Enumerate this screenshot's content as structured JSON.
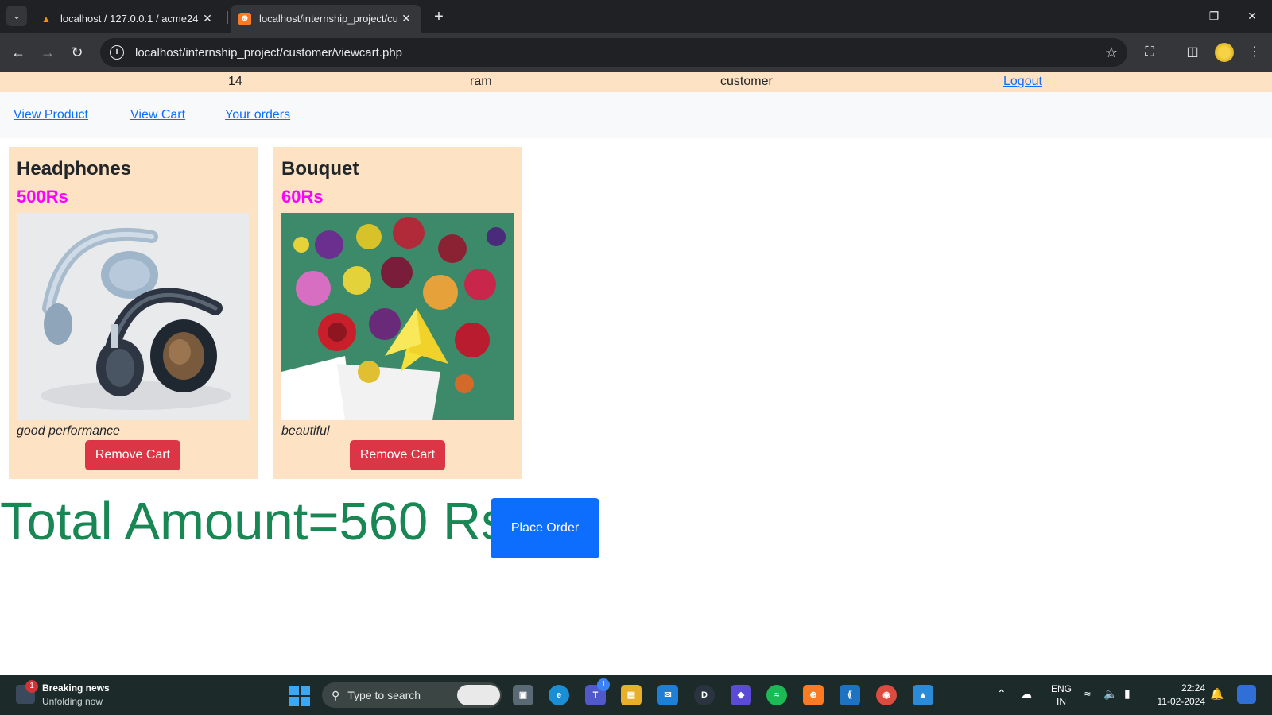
{
  "browser": {
    "tabs": [
      {
        "title": "localhost / 127.0.0.1 / acme24 /",
        "icon": "phpmyadmin-icon",
        "active": false
      },
      {
        "title": "localhost/internship_project/cu",
        "icon": "xampp-icon",
        "active": true
      }
    ],
    "url": "localhost/internship_project/customer/viewcart.php"
  },
  "page": {
    "info_bar": {
      "user_id": "14",
      "username": "ram",
      "role": "customer",
      "logout_label": "Logout"
    },
    "nav": {
      "view_product": "View Product",
      "view_cart": "View Cart",
      "your_orders": "Your orders"
    },
    "cart_items": [
      {
        "name": "Headphones",
        "price": "500Rs",
        "description": "good performance",
        "remove_label": "Remove Cart"
      },
      {
        "name": "Bouquet",
        "price": "60Rs",
        "description": "beautiful",
        "remove_label": "Remove Cart"
      }
    ],
    "total_text": "Total Amount=560 Rs",
    "place_order_label": "Place Order",
    "colors": {
      "info_bar_bg": "#fde3c3",
      "card_bg": "#fde3c3",
      "price": "#ff00ff",
      "remove_button": "#dc3545",
      "total": "#198754",
      "place_order_button": "#0d6efd"
    }
  },
  "taskbar": {
    "news_title": "Breaking news",
    "news_subtitle": "Unfolding now",
    "news_badge": "1",
    "search_placeholder": "Type to search",
    "teams_badge": "1",
    "lang_top": "ENG",
    "lang_bottom": "IN",
    "time": "22:24",
    "date": "11-02-2024"
  }
}
